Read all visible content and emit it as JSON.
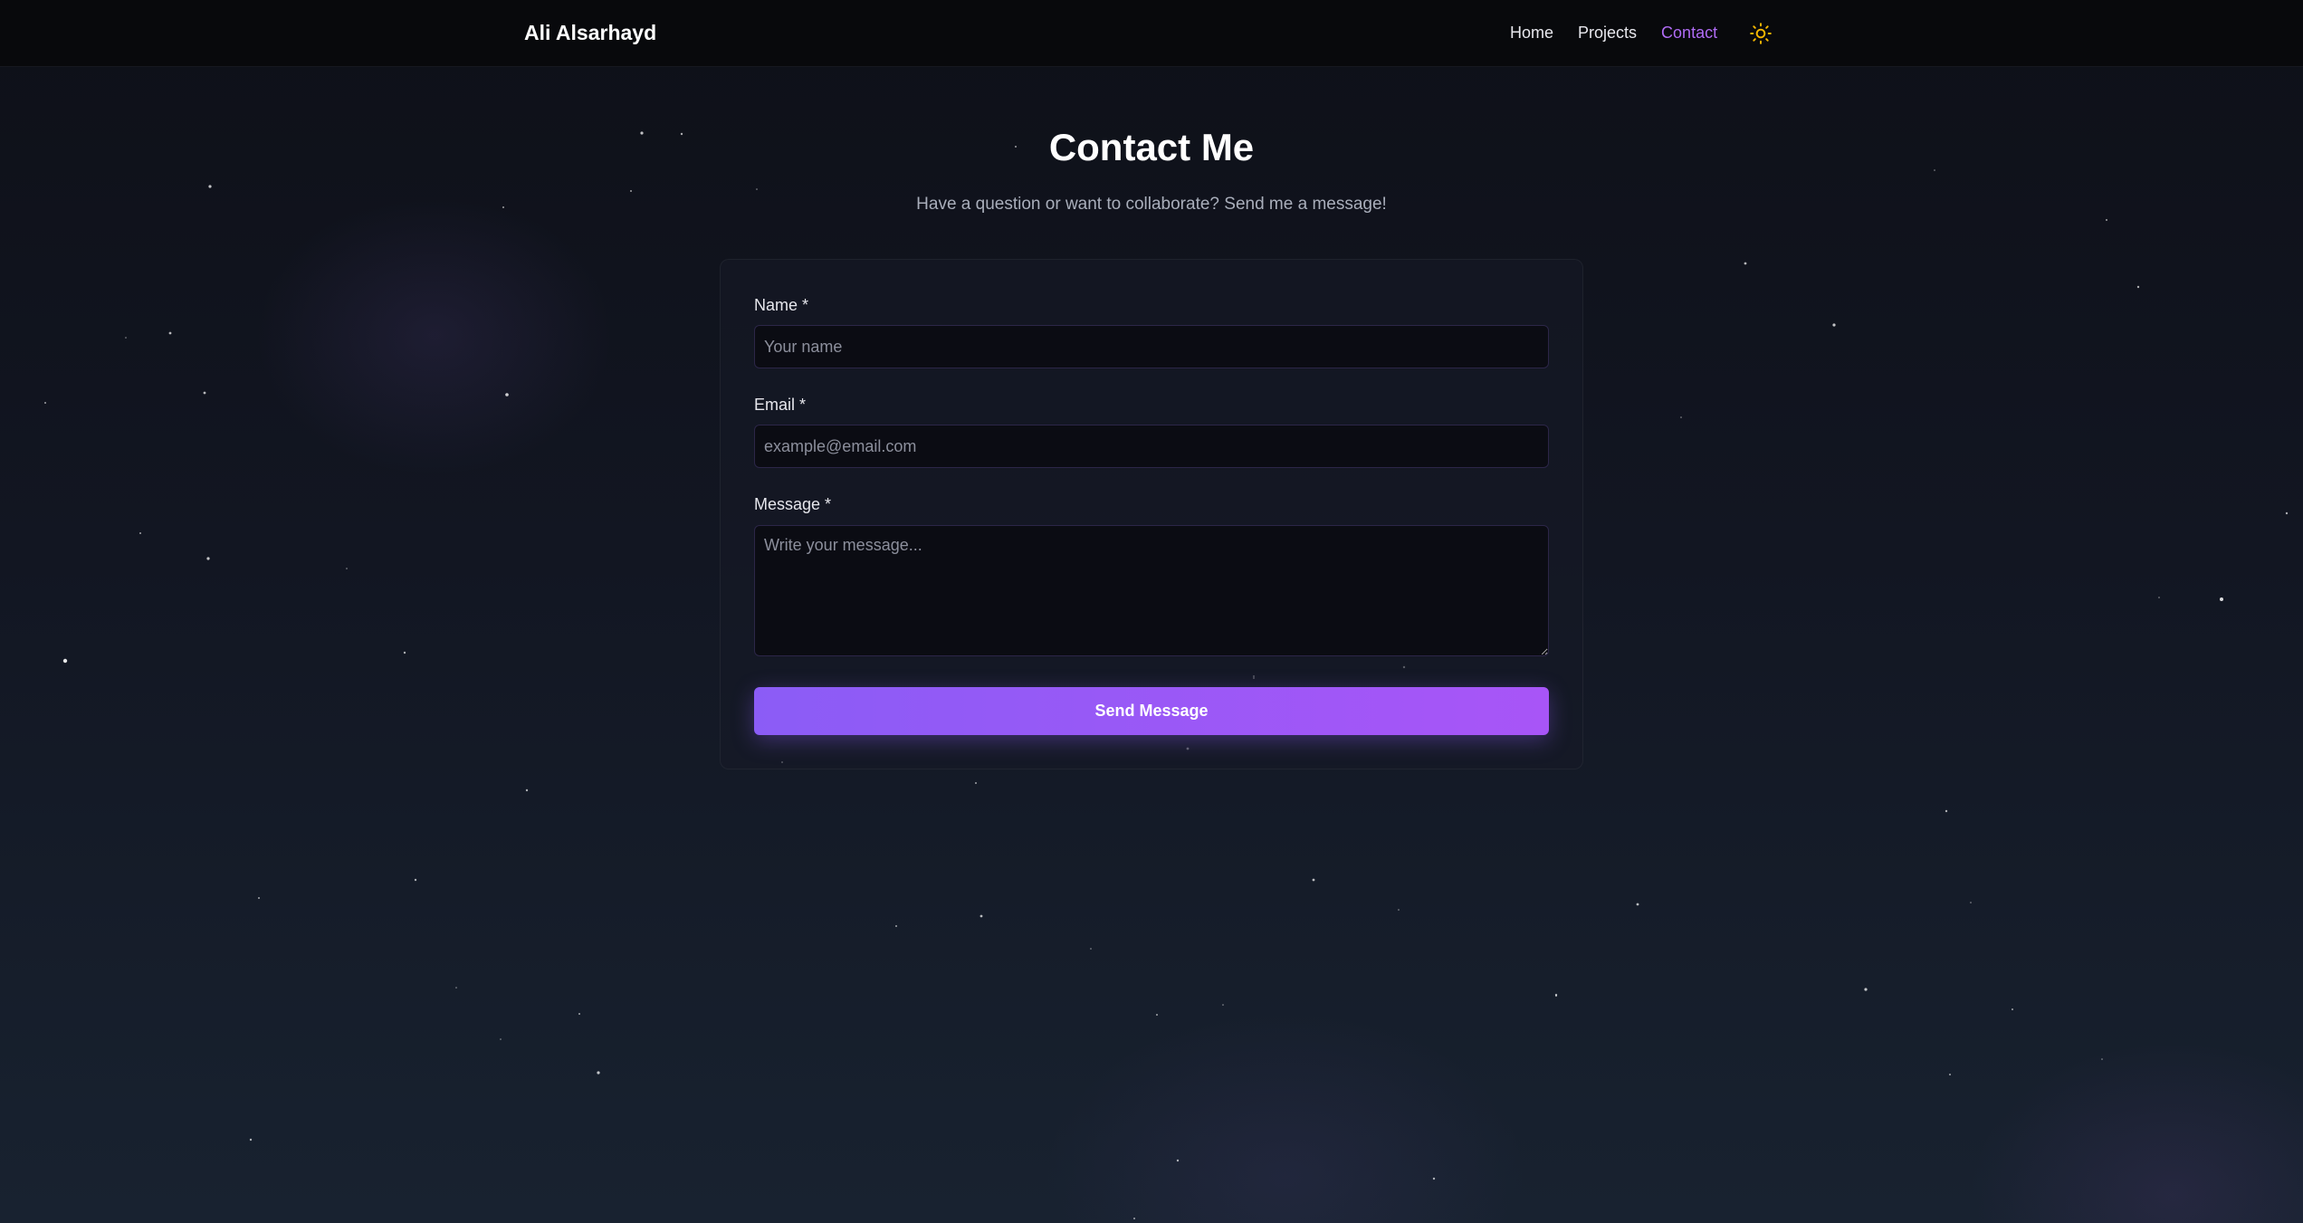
{
  "nav": {
    "brand": "Ali Alsarhayd",
    "links": [
      {
        "label": "Home",
        "active": false
      },
      {
        "label": "Projects",
        "active": false
      },
      {
        "label": "Contact",
        "active": true
      }
    ],
    "theme_toggle_icon": "sun-icon"
  },
  "main": {
    "title": "Contact Me",
    "subtitle": "Have a question or want to collaborate? Send me a message!"
  },
  "form": {
    "name": {
      "label": "Name *",
      "placeholder": "Your name",
      "value": ""
    },
    "email": {
      "label": "Email *",
      "placeholder": "example@email.com",
      "value": ""
    },
    "message": {
      "label": "Message *",
      "placeholder": "Write your message...",
      "value": ""
    },
    "submit_label": "Send Message"
  },
  "colors": {
    "accent": "#a855f7",
    "accent_start": "#8b5cf6",
    "active_nav": "#b06cf5",
    "sun_icon": "#f5b700",
    "background": "#121622"
  }
}
